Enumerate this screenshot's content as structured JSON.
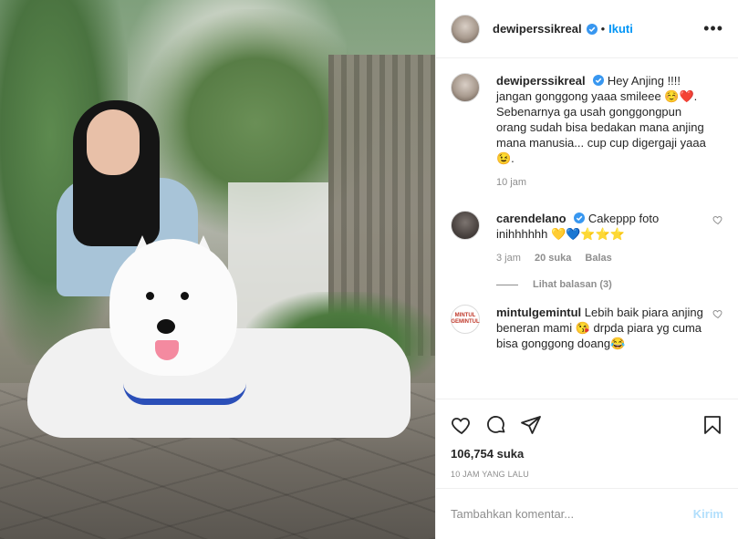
{
  "header": {
    "username": "dewiperssikreal",
    "separator": "•",
    "follow_label": "Ikuti",
    "more_label": "•••"
  },
  "caption": {
    "username": "dewiperssikreal",
    "text": "Hey Anjing !!!! jangan gonggong yaaa smileee ☺️❤️. Sebenarnya ga usah gonggongpun orang sudah bisa bedakan mana anjing mana manusia... cup cup digergaji yaaa 😉.",
    "time": "10 jam"
  },
  "comments": [
    {
      "username": "carendelano",
      "text": "Cakeppp foto inihhhhhh 💛💙⭐⭐⭐",
      "time": "3 jam",
      "likes": "20 suka",
      "reply_label": "Balas",
      "replies_label": "Lihat balasan (3)"
    },
    {
      "username": "mintulgemintul",
      "avatar_text": "MINTUL GEMINTUL",
      "text": "Lebih baik piara anjing beneran mami 😘 drpda piara yg cuma bisa gonggong doang😂"
    }
  ],
  "actions": {
    "likes": "106,754 suka",
    "posted": "10 JAM YANG LALU"
  },
  "add_comment": {
    "placeholder": "Tambahkan komentar...",
    "post_label": "Kirim"
  },
  "colors": {
    "accent": "#0095f6",
    "post_disabled": "#b2dffc",
    "muted": "#8e8e8e",
    "text": "#262626"
  },
  "icons": [
    "verified-icon",
    "heart-icon",
    "comment-icon",
    "share-icon",
    "bookmark-icon"
  ]
}
